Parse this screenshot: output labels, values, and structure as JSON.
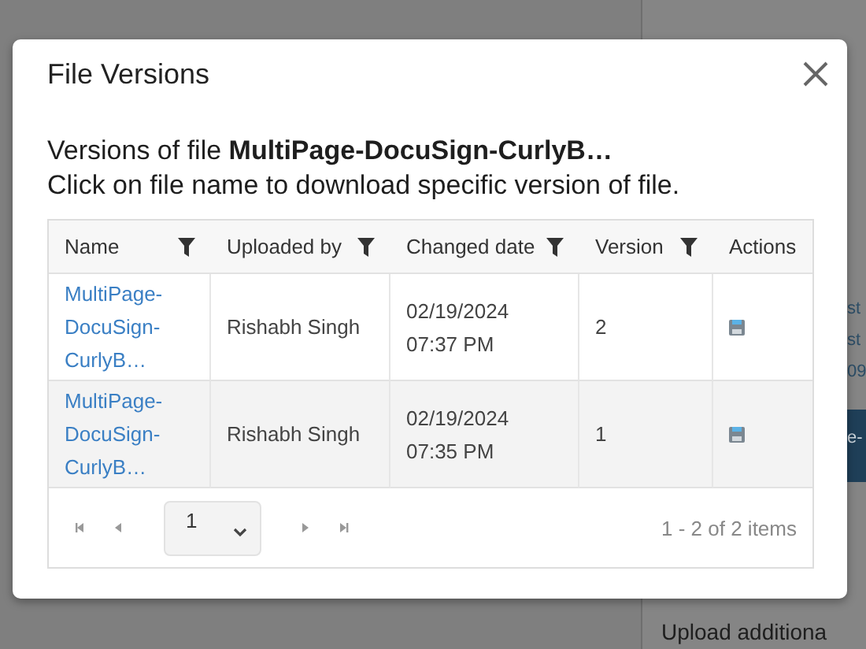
{
  "background": {
    "fragments": [
      "st",
      "st",
      "09",
      "e-"
    ],
    "footer_text": "Upload additiona"
  },
  "dialog": {
    "title": "File Versions",
    "intro": "Versions of file **MultiPage-DocuSign-CurlyB…**",
    "instruction": "Click on file name to download specific version of file.",
    "table": {
      "columns": [
        {
          "label": "Name",
          "filter": true
        },
        {
          "label": "Uploaded by",
          "filter": true
        },
        {
          "label": "Changed date",
          "filter": true
        },
        {
          "label": "Version",
          "filter": true
        },
        {
          "label": "Actions",
          "filter": false
        }
      ],
      "rows": [
        {
          "name": "MultiPage-DocuSign-CurlyB…",
          "uploaded_by": "Rishabh Singh",
          "date": "02/19/2024",
          "time": "07:37 PM",
          "version": "2"
        },
        {
          "name": "MultiPage-DocuSign-CurlyB…",
          "uploaded_by": "Rishabh Singh",
          "date": "02/19/2024",
          "time": "07:35 PM",
          "version": "1"
        }
      ]
    },
    "pager": {
      "page": "1",
      "summary": "1 - 2 of 2 items"
    }
  }
}
